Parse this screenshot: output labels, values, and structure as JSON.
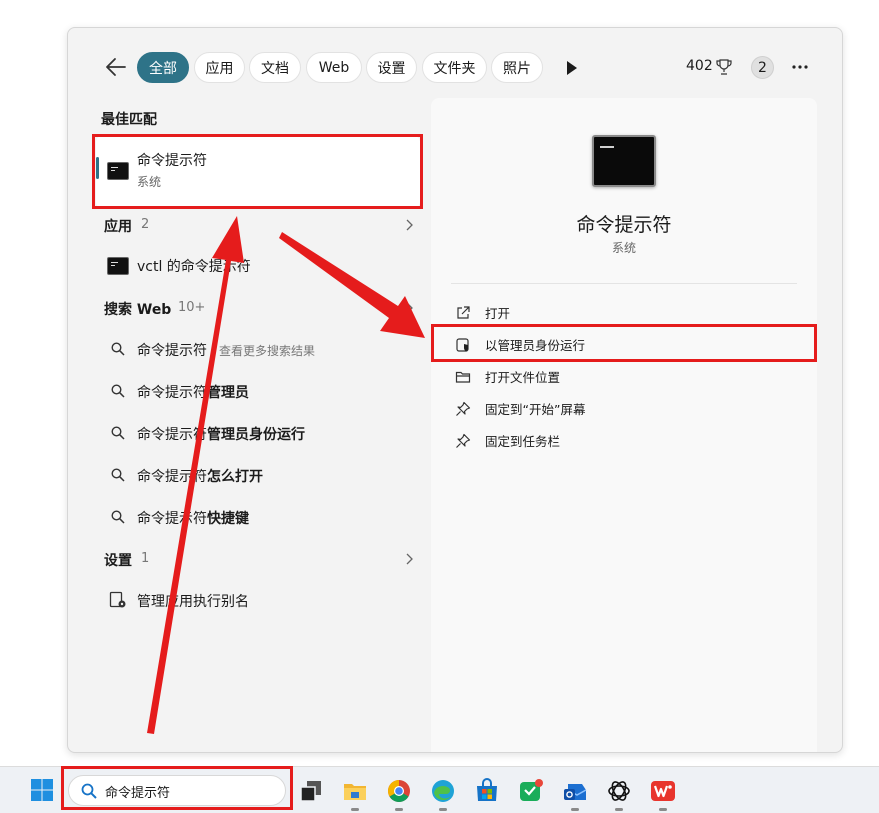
{
  "filters": {
    "tabs": [
      "全部",
      "应用",
      "文档",
      "Web",
      "设置",
      "文件夹",
      "照片"
    ],
    "points": "402",
    "notification_count": "2"
  },
  "best_match": {
    "section_title": "最佳匹配",
    "title": "命令提示符",
    "subtitle": "系统"
  },
  "apps": {
    "section_title": "应用",
    "count": "2",
    "items": [
      {
        "label": "vctl 的命令提示符"
      }
    ]
  },
  "web": {
    "section_title": "搜索 Web",
    "count": "10+",
    "items": [
      {
        "prefix": "命令提示符",
        "suffix": " - 查看更多搜索结果"
      },
      {
        "prefix": "命令提示符",
        "suffix": "管理员"
      },
      {
        "prefix": "命令提示符",
        "suffix": "管理员身份运行"
      },
      {
        "prefix": "命令提示符",
        "suffix": "怎么打开"
      },
      {
        "prefix": "命令提示符",
        "suffix": "快捷键"
      }
    ]
  },
  "settings": {
    "section_title": "设置",
    "count": "1",
    "items": [
      {
        "label": "管理应用执行别名"
      }
    ]
  },
  "detail": {
    "title": "命令提示符",
    "subtitle": "系统",
    "actions": [
      "打开",
      "以管理员身份运行",
      "打开文件位置",
      "固定到“开始”屏幕",
      "固定到任务栏"
    ]
  },
  "taskbar": {
    "search_value": "命令提示符"
  },
  "colors": {
    "accent": "#2e7388",
    "annotation_red": "#e51c1c"
  }
}
